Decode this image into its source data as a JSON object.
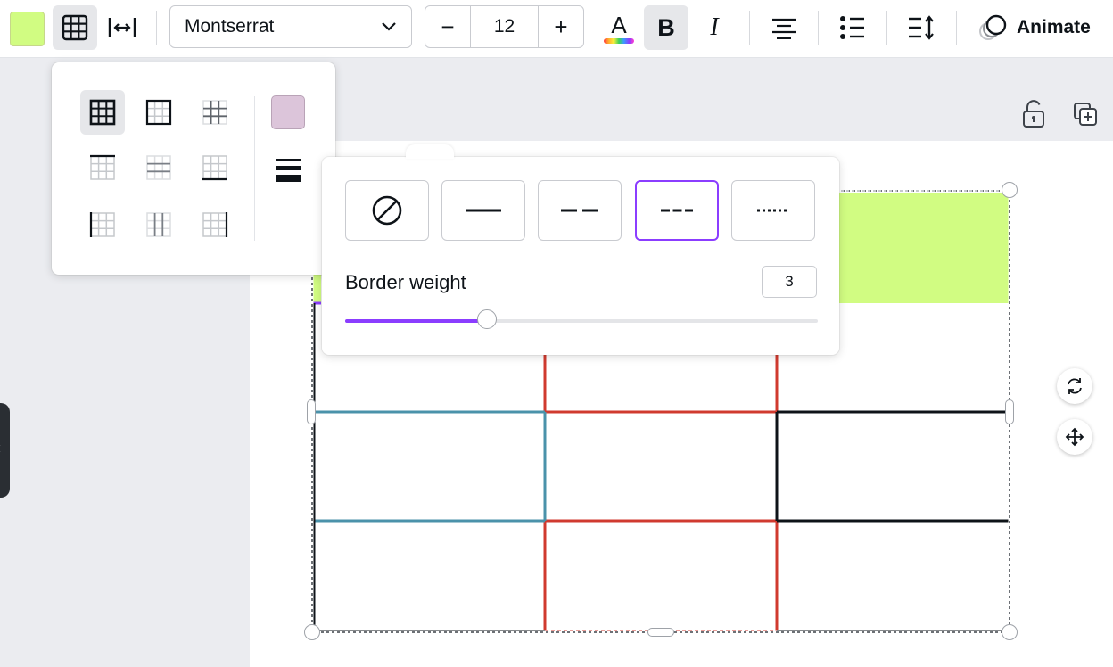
{
  "toolbar": {
    "fill_color": "#d1fc82",
    "font_family": "Montserrat",
    "font_size": "12",
    "decrease_label": "−",
    "increase_label": "+",
    "bold_label": "B",
    "italic_label": "I",
    "animate_label": "Animate",
    "text_color_icon": "text-color-icon",
    "text_color_letter": "A"
  },
  "grid_panel": {
    "border_color": "#dcc5da",
    "options": [
      "all-borders",
      "outer-borders",
      "inner-borders",
      "top-border",
      "horizontal-inner",
      "bottom-border",
      "left-border",
      "vertical-inner",
      "right-border"
    ],
    "selected": "all-borders"
  },
  "border_panel": {
    "styles": [
      "none",
      "solid",
      "long-dash",
      "short-dash",
      "dotted"
    ],
    "selected_style": "short-dash",
    "weight_label": "Border weight",
    "weight_value": "3",
    "weight_fraction": 0.3
  },
  "colors": {
    "accent": "#8b3dff",
    "header_fill": "#d1fc82",
    "red_border": "#d03a2f",
    "teal_border": "#4a92aa",
    "black_border": "#0e1318"
  }
}
